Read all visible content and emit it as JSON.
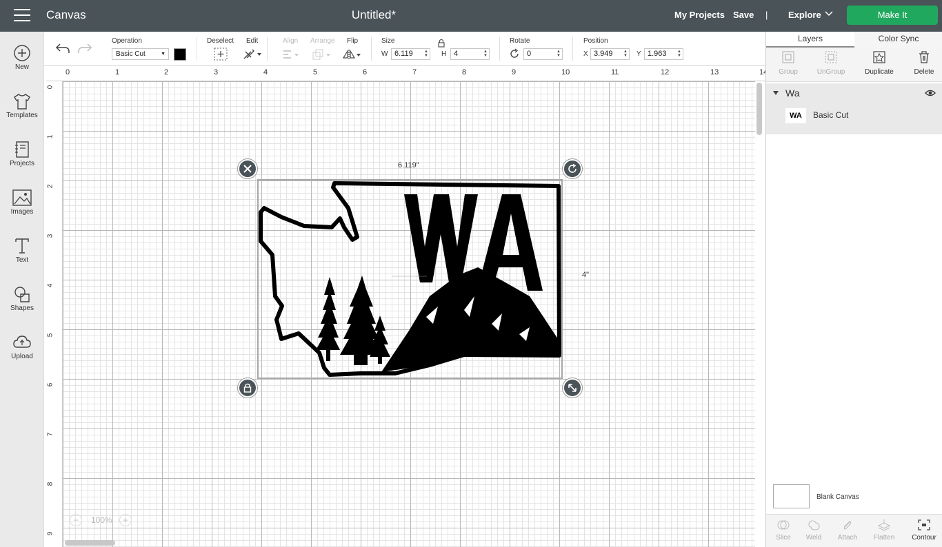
{
  "topbar": {
    "app_title": "Canvas",
    "doc_title": "Untitled*",
    "my_projects": "My Projects",
    "save": "Save",
    "separator": "|",
    "explore": "Explore",
    "make_it": "Make It"
  },
  "sidebar": {
    "items": [
      {
        "label": "New",
        "icon": "plus-circle-icon"
      },
      {
        "label": "Templates",
        "icon": "tshirt-icon"
      },
      {
        "label": "Projects",
        "icon": "notebook-icon"
      },
      {
        "label": "Images",
        "icon": "image-icon"
      },
      {
        "label": "Text",
        "icon": "text-icon"
      },
      {
        "label": "Shapes",
        "icon": "shapes-icon"
      },
      {
        "label": "Upload",
        "icon": "cloud-upload-icon"
      }
    ]
  },
  "toolbar": {
    "operation_label": "Operation",
    "operation_value": "Basic Cut",
    "operation_color": "#000000",
    "deselect_label": "Deselect",
    "edit_label": "Edit",
    "align_label": "Align",
    "arrange_label": "Arrange",
    "flip_label": "Flip",
    "size_label": "Size",
    "w_label": "W",
    "w_value": "6.119",
    "h_label": "H",
    "h_value": "4",
    "rotate_label": "Rotate",
    "rotate_value": "0",
    "position_label": "Position",
    "x_label": "X",
    "x_value": "3.949",
    "y_label": "Y",
    "y_value": "1.963"
  },
  "canvas": {
    "ruler_top": [
      "0",
      "1",
      "2",
      "3",
      "4",
      "5",
      "6",
      "7",
      "8",
      "9",
      "10",
      "11",
      "12",
      "13",
      "14"
    ],
    "ruler_left": [
      "0",
      "1",
      "2",
      "3",
      "4",
      "5",
      "6",
      "7",
      "8",
      "9"
    ],
    "width_dim": "6.119\"",
    "height_dim": "4\"",
    "zoom": "100%",
    "design_text": "WA"
  },
  "right_panel": {
    "tabs": [
      "Layers",
      "Color Sync"
    ],
    "tools": {
      "group": "Group",
      "ungroup": "UnGroup",
      "duplicate": "Duplicate",
      "delete": "Delete"
    },
    "layer_group_name": "Wa",
    "layer_item_name": "Basic Cut",
    "layer_thumb_text": "WA",
    "blank_canvas": "Blank Canvas",
    "bottom_tools": {
      "slice": "Slice",
      "weld": "Weld",
      "attach": "Attach",
      "flatten": "Flatten",
      "contour": "Contour"
    }
  },
  "colors": {
    "topbar_bg": "#4a5358",
    "make_it_green": "#20a95e",
    "handle_bg": "#4a5358"
  }
}
